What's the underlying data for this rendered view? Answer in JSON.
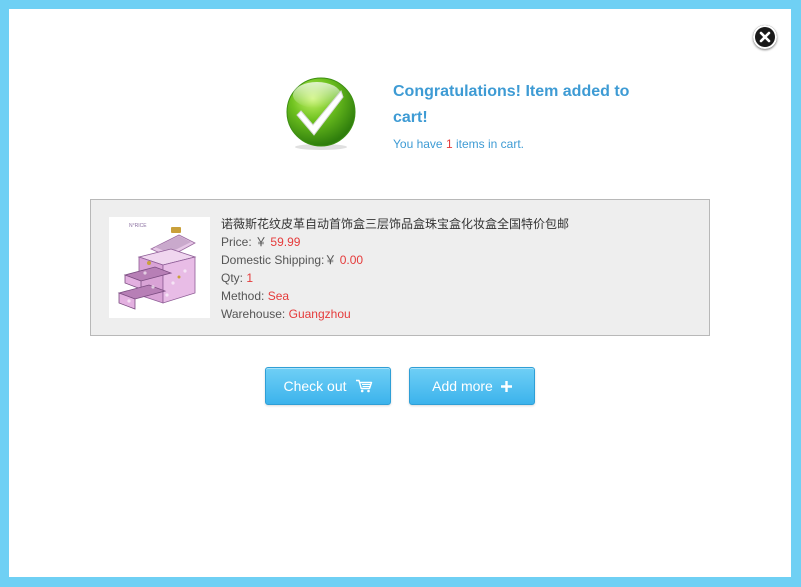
{
  "dialog": {
    "close_icon": "close-icon",
    "success_icon": "checkmark-icon",
    "title": "Congratulations! Item added to cart!",
    "cart_prefix": "You have",
    "cart_count": "1",
    "cart_suffix": "items in cart."
  },
  "item": {
    "name": "诺薇斯花纹皮革自动首饰盒三层饰品盒珠宝盒化妆盒全国特价包邮",
    "price_label": "Price:",
    "price_currency": "￥",
    "price_value": "59.99",
    "shipping_label": "Domestic Shipping:",
    "shipping_currency": "￥",
    "shipping_value": "0.00",
    "qty_label": "Qty:",
    "qty_value": "1",
    "method_label": "Method:",
    "method_value": "Sea",
    "warehouse_label": "Warehouse:",
    "warehouse_value": "Guangzhou",
    "thumb_brand": "N°RICE"
  },
  "actions": {
    "checkout_label": "Check out",
    "checkout_icon": "cart-icon",
    "addmore_label": "Add more",
    "addmore_icon": "plus-icon"
  },
  "colors": {
    "accent": "#3e9bd4",
    "highlight": "#e53b3b",
    "button": "#3cb3ec",
    "frame": "#6fd0f4"
  }
}
